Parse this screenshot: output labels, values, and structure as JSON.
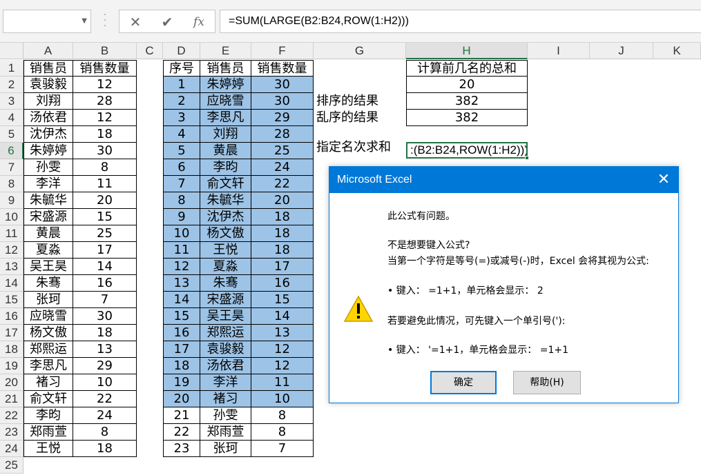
{
  "formula_bar": {
    "name_box": "",
    "cancel_icon": "✕",
    "enter_icon": "✔",
    "fx_icon": "fx",
    "formula": "=SUM(LARGE(B2:B24,ROW(1:H2)))"
  },
  "columns": [
    "A",
    "B",
    "C",
    "D",
    "E",
    "F",
    "G",
    "H",
    "I",
    "J",
    "K"
  ],
  "selected_column": "H",
  "rows": [
    "1",
    "2",
    "3",
    "4",
    "5",
    "6",
    "7",
    "8",
    "9",
    "10",
    "11",
    "12",
    "13",
    "14",
    "15",
    "16",
    "17",
    "18",
    "19",
    "20",
    "21",
    "22",
    "23",
    "24",
    "25"
  ],
  "selected_row": "6",
  "table_left": {
    "headers": [
      "销售员",
      "销售数量"
    ],
    "rows": [
      [
        "袁骏毅",
        "12"
      ],
      [
        "刘翔",
        "28"
      ],
      [
        "汤依君",
        "12"
      ],
      [
        "沈伊杰",
        "18"
      ],
      [
        "朱婷婷",
        "30"
      ],
      [
        "孙雯",
        "8"
      ],
      [
        "李洋",
        "11"
      ],
      [
        "朱毓华",
        "20"
      ],
      [
        "宋盛源",
        "15"
      ],
      [
        "黄晨",
        "25"
      ],
      [
        "夏淼",
        "17"
      ],
      [
        "吴王昊",
        "14"
      ],
      [
        "朱骞",
        "16"
      ],
      [
        "张珂",
        "7"
      ],
      [
        "应晓雪",
        "30"
      ],
      [
        "杨文傲",
        "18"
      ],
      [
        "郑熙运",
        "13"
      ],
      [
        "李思凡",
        "29"
      ],
      [
        "褚习",
        "10"
      ],
      [
        "俞文轩",
        "22"
      ],
      [
        "李昀",
        "24"
      ],
      [
        "郑雨萱",
        "8"
      ],
      [
        "王悦",
        "18"
      ]
    ]
  },
  "table_sorted": {
    "headers": [
      "序号",
      "销售员",
      "销售数量"
    ],
    "rows": [
      [
        "1",
        "朱婷婷",
        "30"
      ],
      [
        "2",
        "应晓雪",
        "30"
      ],
      [
        "3",
        "李思凡",
        "29"
      ],
      [
        "4",
        "刘翔",
        "28"
      ],
      [
        "5",
        "黄晨",
        "25"
      ],
      [
        "6",
        "李昀",
        "24"
      ],
      [
        "7",
        "俞文轩",
        "22"
      ],
      [
        "8",
        "朱毓华",
        "20"
      ],
      [
        "9",
        "沈伊杰",
        "18"
      ],
      [
        "10",
        "杨文傲",
        "18"
      ],
      [
        "11",
        "王悦",
        "18"
      ],
      [
        "12",
        "夏淼",
        "17"
      ],
      [
        "13",
        "朱骞",
        "16"
      ],
      [
        "14",
        "宋盛源",
        "15"
      ],
      [
        "15",
        "吴王昊",
        "14"
      ],
      [
        "16",
        "郑熙运",
        "13"
      ],
      [
        "17",
        "袁骏毅",
        "12"
      ],
      [
        "18",
        "汤依君",
        "12"
      ],
      [
        "19",
        "李洋",
        "11"
      ],
      [
        "20",
        "褚习",
        "10"
      ],
      [
        "21",
        "孙雯",
        "8"
      ],
      [
        "22",
        "郑雨萱",
        "8"
      ],
      [
        "23",
        "张珂",
        "7"
      ]
    ],
    "highlighted_rows": 20,
    "highlight_color": "#9dc3e6"
  },
  "calc": {
    "header": "计算前几名的总和",
    "n_value": "20",
    "sorted_label": "排序的结果",
    "sorted_value": "382",
    "unsorted_label": "乱序的结果",
    "unsorted_value": "382",
    "rank_label": "指定名次求和",
    "active_cell_text": ":(B2:B24,ROW(1:H2)))"
  },
  "dialog": {
    "title": "Microsoft Excel",
    "close_icon": "✕",
    "line1": "此公式有问题。",
    "line2": "不是想要键入公式?",
    "line3": "当第一个字符是等号(=)或减号(-)时，Excel 会将其视为公式:",
    "line4": "• 键入：  =1+1，单元格会显示：  2",
    "line5": "若要避免此情况，可先键入一个单引号('):",
    "line6": "• 键入：  '=1+1，单元格会显示：  =1+1",
    "ok_label": "确定",
    "help_label": "帮助(H)",
    "icon": "warning-icon",
    "accent_color": "#0078d7"
  }
}
